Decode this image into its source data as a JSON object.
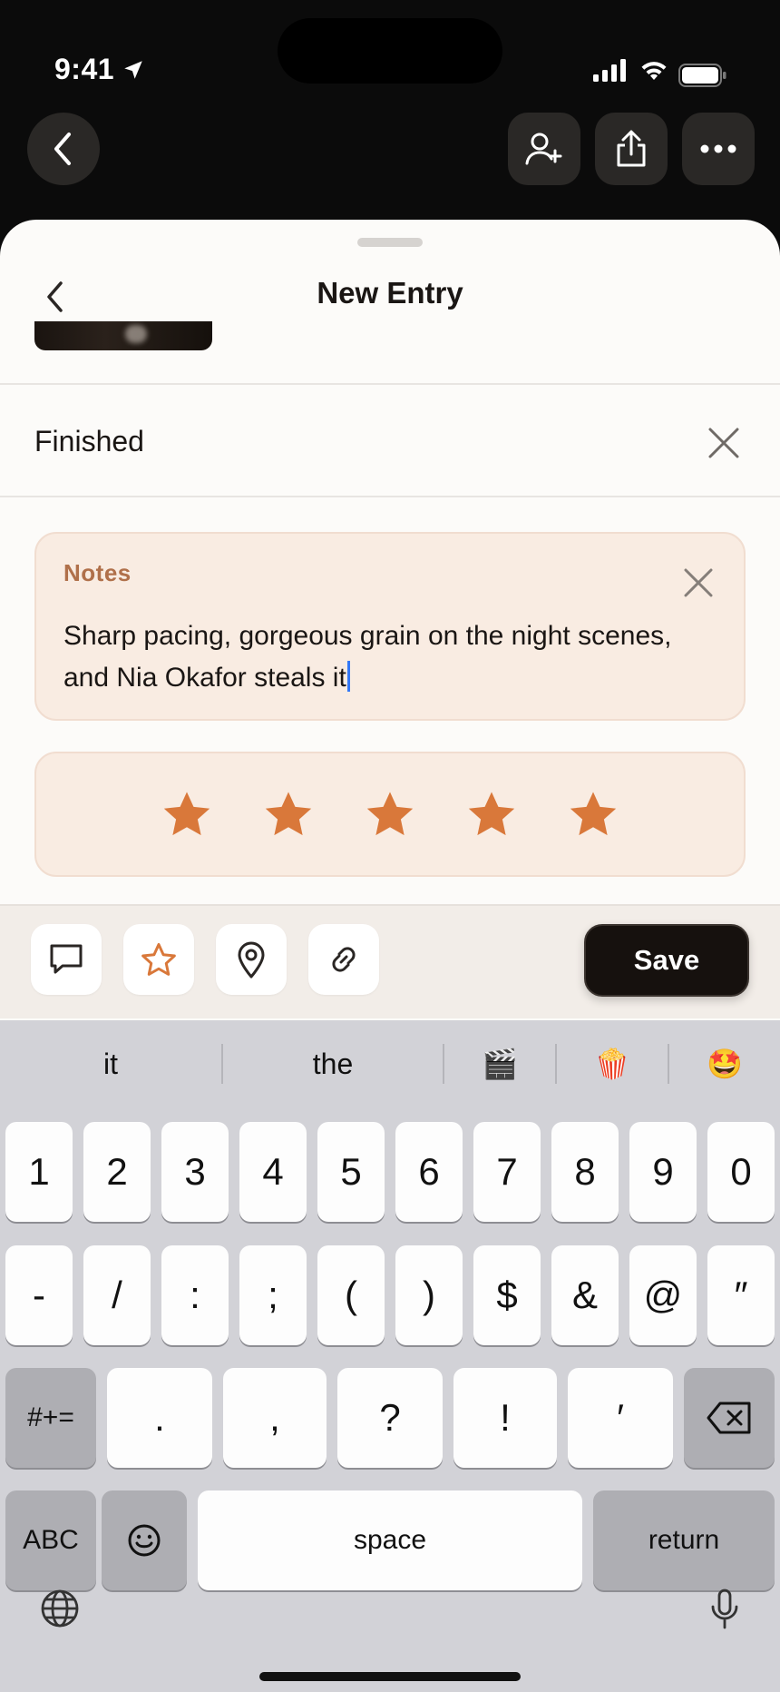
{
  "status_bar": {
    "time": "9:41"
  },
  "sheet": {
    "title": "New Entry",
    "status_row_label": "Finished",
    "notes": {
      "heading": "Notes",
      "text_line1": "Sharp pacing, gorgeous grain on the night scenes,",
      "text_line2": "and Nia Okafor steals it"
    },
    "rating": {
      "value": 5,
      "max": 5
    },
    "save_label": "Save"
  },
  "keyboard": {
    "suggestions": [
      "it",
      "the",
      "🎬",
      "🍿",
      "🤩"
    ],
    "row1": [
      "1",
      "2",
      "3",
      "4",
      "5",
      "6",
      "7",
      "8",
      "9",
      "0"
    ],
    "row2": [
      "-",
      "/",
      ":",
      ";",
      "(",
      ")",
      "$",
      "&",
      "@",
      "″"
    ],
    "row3_left": "#+=",
    "row3": [
      ".",
      ",",
      "?",
      "!",
      "′"
    ],
    "abc_label": "ABC",
    "space_label": "space",
    "return_label": "return"
  },
  "colors": {
    "accent": "#d9783a",
    "notes_bg": "#f9ece2",
    "notes_heading": "#b0704a",
    "save_bg": "#16110e"
  }
}
